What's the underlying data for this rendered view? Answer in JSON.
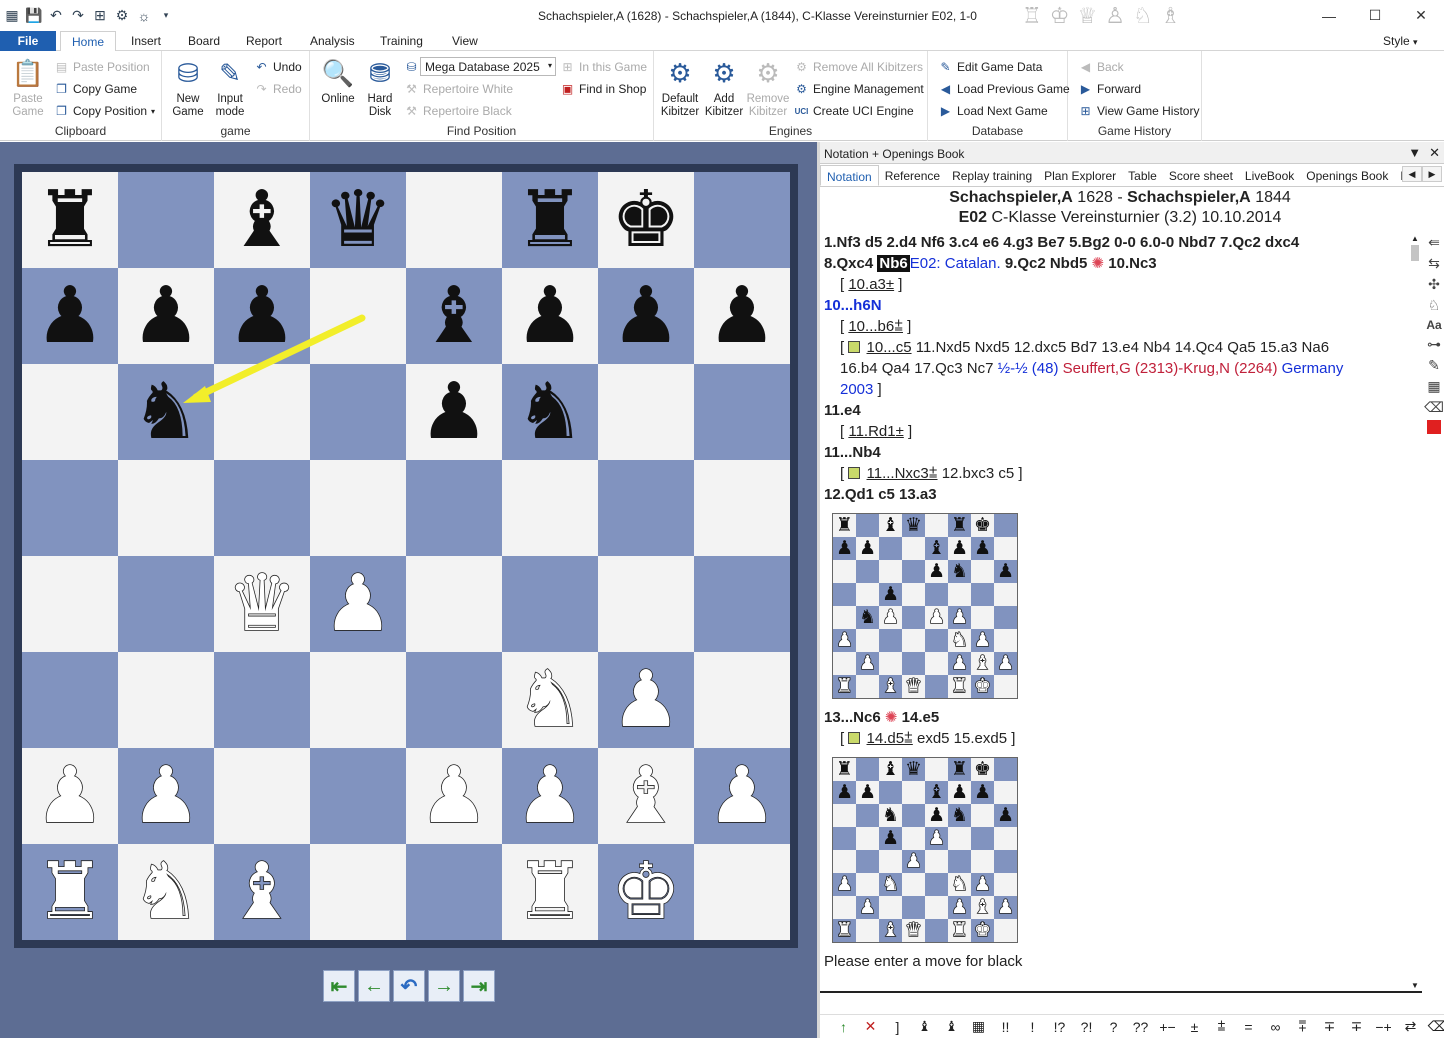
{
  "window": {
    "title": "Schachspieler,A (1628) - Schachspieler,A (1844), C-Klasse Vereinsturnier  E02, 1-0"
  },
  "ribbon_tabs": {
    "file": "File",
    "home": "Home",
    "insert": "Insert",
    "board": "Board",
    "report": "Report",
    "analysis": "Analysis",
    "training": "Training",
    "view": "View",
    "style": "Style"
  },
  "clipboard": {
    "paste_game": "Paste Game",
    "paste_position": "Paste Position",
    "copy_game": "Copy Game",
    "copy_position": "Copy Position",
    "label": "Clipboard"
  },
  "game": {
    "new_game": "New Game",
    "input_mode": "Input mode",
    "undo": "Undo",
    "redo": "Redo",
    "label": "game"
  },
  "find": {
    "online": "Online",
    "hard_disk": "Hard Disk",
    "database": "Mega Database 2025",
    "in_this_game": "In this Game",
    "repertoire_white": "Repertoire White",
    "find_in_shop": "Find in Shop",
    "repertoire_black": "Repertoire Black",
    "label": "Find Position"
  },
  "engines": {
    "default_kibitzer": "Default Kibitzer",
    "add_kibitzer": "Add Kibitzer",
    "remove_kibitzer": "Remove Kibitzer",
    "remove_all": "Remove All Kibitzers",
    "engine_mgmt": "Engine Management",
    "create_uci": "Create UCI Engine",
    "label": "Engines"
  },
  "database": {
    "edit": "Edit Game Data",
    "prev": "Load Previous Game",
    "next": "Load Next Game",
    "label": "Database"
  },
  "history": {
    "back": "Back",
    "forward": "Forward",
    "view": "View Game History",
    "label": "Game History"
  },
  "board": {
    "rows": [
      [
        "♜",
        "",
        "♝",
        "♛",
        "",
        "♜",
        "♚",
        ""
      ],
      [
        "♟",
        "♟",
        "♟",
        "",
        "♝",
        "♟",
        "♟",
        "♟"
      ],
      [
        "",
        "♞",
        "",
        "",
        "♟",
        "♞",
        "",
        ""
      ],
      [
        "",
        "",
        "",
        "",
        "",
        "",
        "",
        ""
      ],
      [
        "",
        "",
        "♕",
        "♙",
        "",
        "",
        "",
        ""
      ],
      [
        "",
        "",
        "",
        "",
        "",
        "♘",
        "♙",
        ""
      ],
      [
        "♙",
        "♙",
        "",
        "",
        "♙",
        "♙",
        "♗",
        "♙"
      ],
      [
        "♖",
        "♘",
        "♗",
        "",
        "",
        "♖",
        "♔",
        ""
      ]
    ],
    "colors": {
      "light": "#f3f3f3",
      "dark": "#8193bf",
      "arrow": "#f2ee2a"
    }
  },
  "panel": {
    "title": "Notation + Openings Book",
    "tabs": [
      "Notation",
      "Reference",
      "Replay training",
      "Plan Explorer",
      "Table",
      "Score sheet",
      "LiveBook",
      "Openings Book",
      "M"
    ]
  },
  "header": {
    "white": "Schachspieler,A",
    "white_elo": "1628",
    "black": "Schachspieler,A",
    "black_elo": "1844",
    "eco": "E02",
    "event": "C-Klasse Vereinsturnier (3.2) 10.10.2014"
  },
  "notation": {
    "l1": "1.Nf3  d5  2.d4  Nf6  3.c4  e6  4.g3  Be7  5.Bg2  0-0  6.0-0  Nbd7  7.Qc2  dxc4",
    "l2a": "8.Qxc4",
    "l2b": "Nb6",
    "l2c": "E02: Catalan.",
    "l2d": "9.Qc2  Nbd5",
    "l2e": "10.Nc3",
    "v1": "10.a3±",
    "l3": "10...h6N",
    "v2": "10...b6⩲",
    "v3a": "10...c5",
    "v3b": "11.Nxd5  Nxd5  12.dxc5  Bd7  13.e4  Nb4  14.Qc4  Qa5  15.a3  Na6",
    "v3c": "16.b4  Qa4  17.Qc3  Nc7",
    "v3d": "½-½ (48)",
    "v3e": "Seuffert,G (2313)-Krug,N (2264)",
    "v3f": "Germany",
    "v3g": "2003",
    "l4": "11.e4",
    "v4": "11.Rd1±",
    "l5": "11...Nb4",
    "v5a": "11...Nxc3⩲",
    "v5b": "12.bxc3  c5",
    "l6": "12.Qd1  c5  13.a3",
    "l7a": "13...Nc6",
    "l7b": "14.e5",
    "v6a": "14.d5⩲",
    "v6b": "exd5  15.exd5",
    "prompt": "Please enter a move for black"
  },
  "mini1": [
    [
      "♜",
      "",
      "♝",
      "♛",
      "",
      "♜",
      "♚",
      ""
    ],
    [
      "♟",
      "♟",
      "",
      "",
      "♝",
      "♟",
      "♟",
      ""
    ],
    [
      "",
      "",
      "",
      "",
      "♟",
      "♞",
      "",
      "♟"
    ],
    [
      "",
      "",
      "♟",
      "",
      "",
      "",
      "",
      ""
    ],
    [
      "",
      "♞",
      "♙",
      "",
      "♙",
      "♙",
      "",
      ""
    ],
    [
      "♙",
      "",
      "",
      "",
      "",
      "♘",
      "♙",
      ""
    ],
    [
      "",
      "♙",
      "",
      "",
      "",
      "♙",
      "♗",
      "♙"
    ],
    [
      "♖",
      "",
      "♗",
      "♕",
      "",
      "♖",
      "♔",
      ""
    ]
  ],
  "mini2": [
    [
      "♜",
      "",
      "♝",
      "♛",
      "",
      "♜",
      "♚",
      ""
    ],
    [
      "♟",
      "♟",
      "",
      "",
      "♝",
      "♟",
      "♟",
      ""
    ],
    [
      "",
      "",
      "♞",
      "",
      "♟",
      "♞",
      "",
      "♟"
    ],
    [
      "",
      "",
      "♟",
      "",
      "♙",
      "",
      "",
      ""
    ],
    [
      "",
      "",
      "",
      "♙",
      "",
      "",
      "",
      ""
    ],
    [
      "♙",
      "",
      "♘",
      "",
      "",
      "♘",
      "♙",
      ""
    ],
    [
      "",
      "♙",
      "",
      "",
      "",
      "♙",
      "♗",
      "♙"
    ],
    [
      "♖",
      "",
      "♗",
      "♕",
      "",
      "♖",
      "♔",
      ""
    ]
  ],
  "symbols": [
    "↑",
    "✕",
    "]",
    "♝",
    "♝",
    "▦",
    "!!",
    "!",
    "!?",
    "?!",
    "?",
    "??",
    "+−",
    "±",
    "⩲",
    "=",
    "∞",
    "⩱",
    "∓",
    "∓",
    "−+",
    "⇄",
    "⌫"
  ]
}
